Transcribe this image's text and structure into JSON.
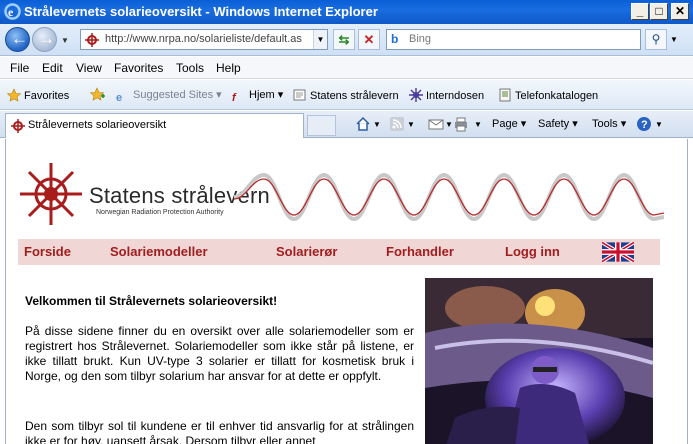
{
  "window": {
    "title": "Strålevernets solarieoversikt - Windows Internet Explorer"
  },
  "address_bar": {
    "url": "http://www.nrpa.no/solarieliste/default.as",
    "search_placeholder": "Bing"
  },
  "menu": [
    "File",
    "Edit",
    "View",
    "Favorites",
    "Tools",
    "Help"
  ],
  "favorites_bar": {
    "favorites_label": "Favorites",
    "suggested_sites": "Suggested Sites",
    "links": [
      "Hjem",
      "Statens strålevern",
      "Interndosen",
      "Telefonkatalogen"
    ]
  },
  "tab": {
    "label": "Strålevernets solarieoversikt"
  },
  "command_bar": {
    "page": "Page",
    "safety": "Safety",
    "tools": "Tools"
  },
  "site": {
    "org_name": "Statens strålevern",
    "org_subtitle": "Norwegian Radiation Protection Authority",
    "nav": [
      "Forside",
      "Solariemodeller",
      "Solarierør",
      "Forhandler",
      "Logg inn"
    ],
    "welcome": "Velkommen til Strålevernets solarieoversikt!",
    "paragraph1": "På disse sidene finner du en oversikt over alle solariemodeller som er registrert hos Strålevernet. Solariemodeller som ikke står på listene, er ikke tillatt brukt. Kun UV-type 3 solarier er tillatt for kosmetisk bruk i Norge, og den som tilbyr solarium har ansvar for at dette er oppfylt.",
    "paragraph2": "Den som tilbyr sol til kundene er til enhver tid ansvarlig for at strålingen ikke er for høy, uansett årsak. Dersom tilbyr eller annet"
  },
  "colors": {
    "nav_bg": "#f1d6d6",
    "nav_text": "#a01e1e",
    "logo_red": "#a81c1c"
  }
}
